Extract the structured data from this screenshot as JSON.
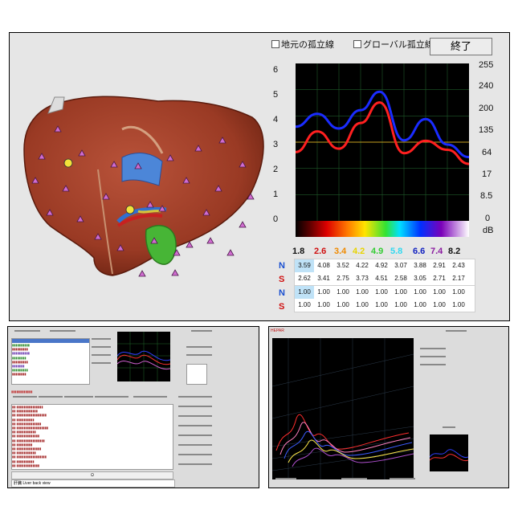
{
  "main_window": {
    "local_isoline_label": "地元の孤立線",
    "global_isoline_label": "グローバル孤立線",
    "end_button_label": "終了",
    "left_axis_ticks": [
      "6",
      "5",
      "4",
      "3",
      "2",
      "1",
      "0"
    ],
    "right_axis_ticks": [
      "255",
      "240",
      "200",
      "135",
      "64",
      "17",
      "8.5",
      "0"
    ],
    "db_label": "dB",
    "spectrum_labels": [
      {
        "text": "1.8",
        "color": "#111111"
      },
      {
        "text": "2.6",
        "color": "#d01010"
      },
      {
        "text": "3.4",
        "color": "#f08a00"
      },
      {
        "text": "4.2",
        "color": "#e8d400"
      },
      {
        "text": "4.9",
        "color": "#33cc33"
      },
      {
        "text": "5.8",
        "color": "#30d8f0"
      },
      {
        "text": "6.6",
        "color": "#1020c0"
      },
      {
        "text": "7.4",
        "color": "#8a1aa0"
      },
      {
        "text": "8.2",
        "color": "#111111"
      }
    ],
    "table1": {
      "row_labels": [
        {
          "text": "N",
          "color": "#1a4fd0"
        },
        {
          "text": "S",
          "color": "#d01010"
        }
      ],
      "rows": [
        [
          "3.59",
          "4.08",
          "3.52",
          "4.22",
          "4.92",
          "3.07",
          "3.88",
          "2.91",
          "2.43"
        ],
        [
          "2.62",
          "3.41",
          "2.75",
          "3.73",
          "4.51",
          "2.58",
          "3.05",
          "2.71",
          "2.17"
        ]
      ]
    },
    "table2": {
      "row_labels": [
        {
          "text": "N",
          "color": "#1a4fd0"
        },
        {
          "text": "S",
          "color": "#d01010"
        }
      ],
      "rows": [
        [
          "1.00",
          "1.00",
          "1.00",
          "1.00",
          "1.00",
          "1.00",
          "1.00",
          "1.00",
          "1.00"
        ],
        [
          "1.00",
          "1.00",
          "1.00",
          "1.00",
          "1.00",
          "1.00",
          "1.00",
          "1.00",
          "1.00"
        ]
      ]
    },
    "chart_data": {
      "type": "line",
      "x": [
        1.8,
        2.6,
        3.4,
        4.2,
        4.9,
        5.8,
        6.6,
        7.4,
        8.2
      ],
      "series": [
        {
          "color": "#1a2cff",
          "values": [
            3.59,
            4.08,
            3.52,
            4.22,
            4.92,
            3.07,
            3.88,
            2.91,
            2.43
          ]
        },
        {
          "color": "#ff2020",
          "values": [
            2.62,
            3.41,
            2.75,
            3.73,
            4.51,
            2.58,
            3.05,
            2.71,
            2.17
          ]
        }
      ],
      "ylim": [
        0,
        6
      ],
      "reference_line_color": "#c7a020",
      "grid": true
    }
  },
  "bottom_left_window": {
    "list_header": "Ω",
    "footer_text": "肝臓 Liver back view"
  },
  "bottom_right_window": {
    "title": "HEPAR"
  }
}
